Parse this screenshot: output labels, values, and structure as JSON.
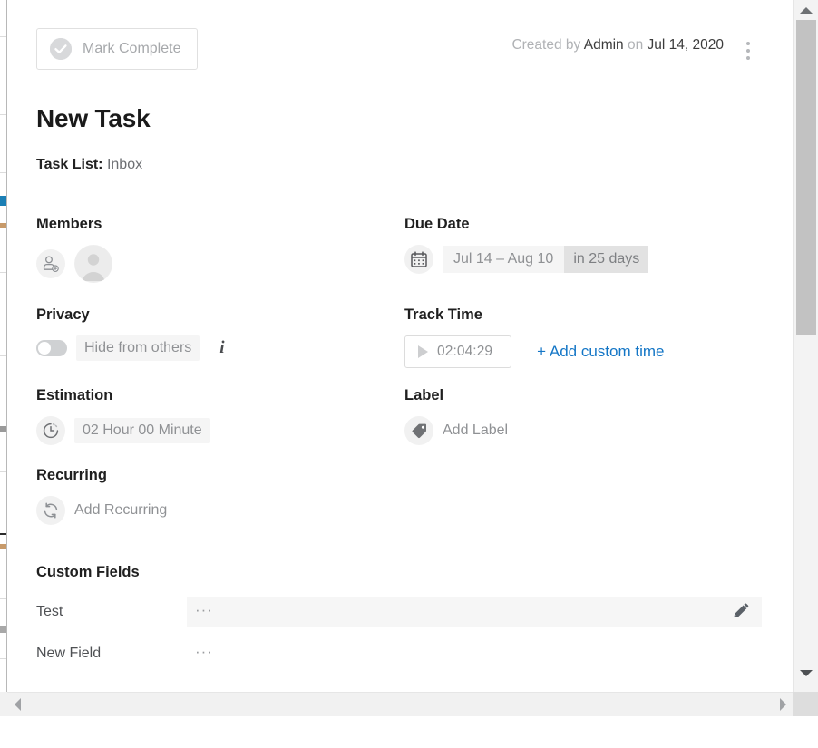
{
  "topbar": {
    "mark_complete_label": "Mark Complete",
    "mark_complete_icon": "check-circle-icon",
    "created_prefix": "Created by ",
    "created_author": "Admin",
    "created_mid": " on ",
    "created_date": "Jul 14, 2020",
    "menu_icon": "kebab-menu-icon"
  },
  "task": {
    "title": "New Task",
    "task_list_key": "Task List:",
    "task_list_value": "Inbox"
  },
  "fields": {
    "members": {
      "heading": "Members",
      "add_icon": "add-member-icon",
      "avatar_icon": "user-avatar-icon"
    },
    "due_date": {
      "heading": "Due Date",
      "icon": "calendar-icon",
      "range": "Jul 14  –  Aug 10",
      "relative": "in 25 days"
    },
    "privacy": {
      "heading": "Privacy",
      "toggle_icon": "toggle-switch-off",
      "label": "Hide from others",
      "info_icon": "info-icon",
      "info_label": "i"
    },
    "track_time": {
      "heading": "Track Time",
      "play_icon": "play-icon",
      "elapsed": "02:04:29",
      "add_custom_label": "+ Add custom time",
      "link_color": "#1476c6"
    },
    "estimation": {
      "heading": "Estimation",
      "icon": "clock-timer-icon",
      "value": "02 Hour   00 Minute"
    },
    "label": {
      "heading": "Label",
      "icon": "tag-icon",
      "placeholder": "Add Label"
    },
    "recurring": {
      "heading": "Recurring",
      "icon": "recurring-refresh-icon",
      "placeholder": "Add Recurring"
    }
  },
  "custom_fields": {
    "heading": "Custom Fields",
    "rows": [
      {
        "label": "Test",
        "value": "···",
        "edit_icon": "pencil-edit-icon",
        "filled": true
      },
      {
        "label": "New Field",
        "value": "···",
        "filled": false
      }
    ]
  },
  "scrollbars": {
    "vertical": {
      "up_icon": "scroll-up-arrow-icon",
      "down_icon": "scroll-down-arrow-icon",
      "thumb_name": "vertical-scroll-thumb"
    },
    "horizontal": {
      "left_icon": "scroll-left-arrow-icon",
      "right_icon": "scroll-right-arrow-icon"
    }
  }
}
